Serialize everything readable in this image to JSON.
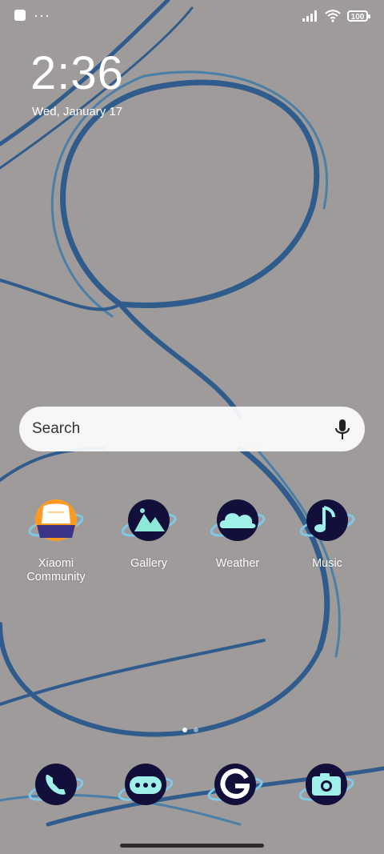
{
  "status": {
    "battery": "100"
  },
  "clock": {
    "time": "2:36",
    "date": "Wed, January 17"
  },
  "search": {
    "placeholder": "Search"
  },
  "apps": [
    {
      "label": "Xiaomi\nCommunity",
      "icon": "xiaomi-community-icon"
    },
    {
      "label": "Gallery",
      "icon": "gallery-icon"
    },
    {
      "label": "Weather",
      "icon": "weather-icon"
    },
    {
      "label": "Music",
      "icon": "music-icon"
    }
  ],
  "dock": [
    {
      "icon": "phone-icon"
    },
    {
      "icon": "messages-icon"
    },
    {
      "icon": "google-icon"
    },
    {
      "icon": "camera-icon"
    }
  ],
  "page_indicator": {
    "count": 2,
    "active": 1
  },
  "colors": {
    "wallpaper": "#9e9b9a",
    "icon_bg": "#12103a",
    "accent": "#7fe0e0"
  }
}
